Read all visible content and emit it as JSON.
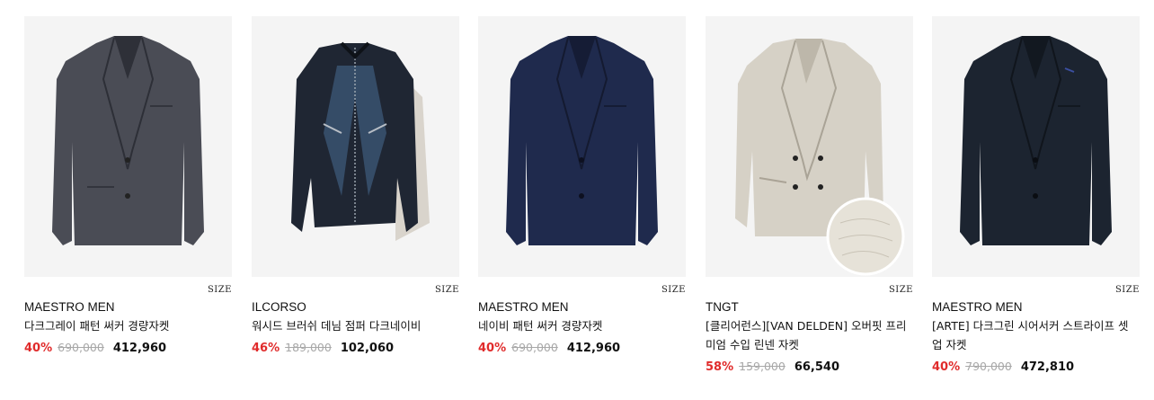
{
  "products": [
    {
      "brand": "MAESTRO MEN",
      "name": "다크그레이 패턴 써커 경량자켓",
      "discount": "40%",
      "original_price": "690,000",
      "sale_price": "412,960",
      "size_label": "SIZE",
      "image_icon": "jacket-dark-gray-icon",
      "color": "#4a4c55"
    },
    {
      "brand": "ILCORSO",
      "name": "워시드 브러쉬 데님 점퍼 다크네이비",
      "discount": "46%",
      "original_price": "189,000",
      "sale_price": "102,060",
      "size_label": "SIZE",
      "image_icon": "denim-jacket-icon",
      "color": "#1f2633"
    },
    {
      "brand": "MAESTRO MEN",
      "name": "네이비 패턴 써커 경량자켓",
      "discount": "40%",
      "original_price": "690,000",
      "sale_price": "412,960",
      "size_label": "SIZE",
      "image_icon": "jacket-navy-icon",
      "color": "#1f2a4d"
    },
    {
      "brand": "TNGT",
      "name": "[클리어런스][VAN DELDEN] 오버핏 프리미엄 수입 린넨 자켓",
      "discount": "58%",
      "original_price": "159,000",
      "sale_price": "66,540",
      "size_label": "SIZE",
      "image_icon": "jacket-linen-beige-icon",
      "color": "#d6d1c6"
    },
    {
      "brand": "MAESTRO MEN",
      "name": "[ARTE] 다크그린 시어서커 스트라이프 셋업 자켓",
      "discount": "40%",
      "original_price": "790,000",
      "sale_price": "472,810",
      "size_label": "SIZE",
      "image_icon": "jacket-dark-green-icon",
      "color": "#1c2430"
    }
  ]
}
